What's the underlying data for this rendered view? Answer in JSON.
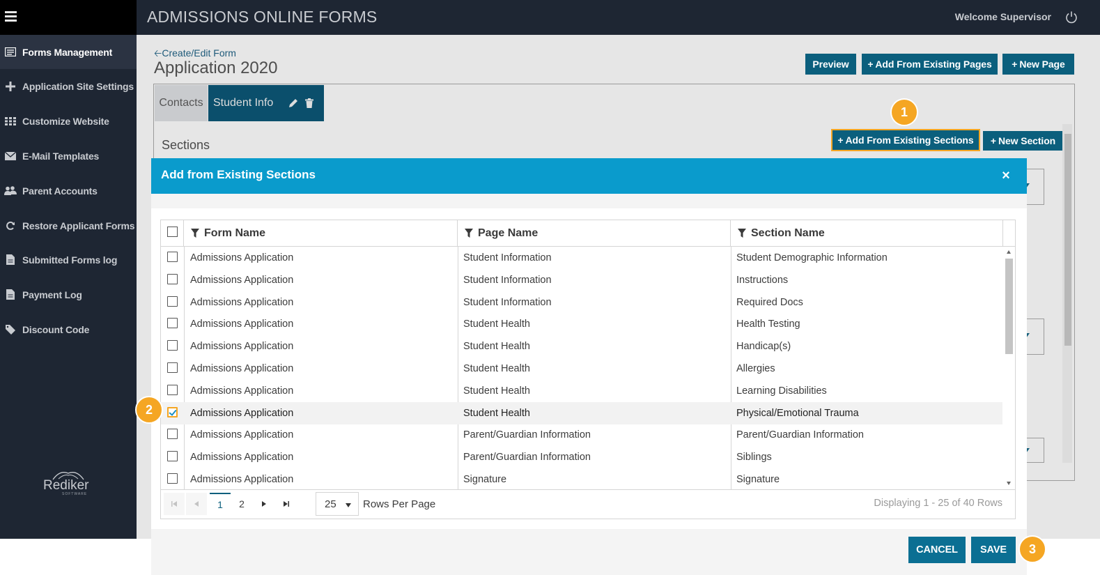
{
  "app": {
    "title": "ADMISSIONS ONLINE FORMS",
    "welcome": "Welcome Supervisor"
  },
  "sidebar": {
    "items": [
      {
        "label": "Forms Management",
        "icon": "form-icon"
      },
      {
        "label": "Application Site Settings",
        "icon": "plus-icon"
      },
      {
        "label": "Customize Website",
        "icon": "grid-icon"
      },
      {
        "label": "E-Mail Templates",
        "icon": "envelope-icon"
      },
      {
        "label": "Parent Accounts",
        "icon": "users-icon"
      },
      {
        "label": "Restore Applicant Forms",
        "icon": "refresh-icon"
      },
      {
        "label": "Submitted Forms log",
        "icon": "document-icon"
      },
      {
        "label": "Payment Log",
        "icon": "document-icon"
      },
      {
        "label": "Discount Code",
        "icon": "tag-icon"
      }
    ],
    "logo_text": "Rediker",
    "logo_sub": "SOFTWARE"
  },
  "main": {
    "breadcrumb": "Create/Edit Form",
    "page_title": "Application 2020",
    "buttons": {
      "preview": "Preview",
      "add_existing_pages": "Add From Existing Pages",
      "new_page": "New Page",
      "add_existing_sections": "Add From Existing Sections",
      "new_section": "New Section"
    },
    "tabs": [
      {
        "label": "Contacts"
      },
      {
        "label": "Student Info"
      }
    ],
    "sections_label": "Sections"
  },
  "modal": {
    "title": "Add from Existing Sections",
    "close": "×",
    "columns": [
      "Form Name",
      "Page Name",
      "Section Name"
    ],
    "rows": [
      {
        "form": "Admissions Application",
        "page": "Student Information",
        "section": "Student Demographic Information",
        "checked": false
      },
      {
        "form": "Admissions Application",
        "page": "Student Information",
        "section": "Instructions",
        "checked": false
      },
      {
        "form": "Admissions Application",
        "page": "Student Information",
        "section": "Required Docs",
        "checked": false
      },
      {
        "form": "Admissions Application",
        "page": "Student Health",
        "section": "Health Testing",
        "checked": false
      },
      {
        "form": "Admissions Application",
        "page": "Student Health",
        "section": "Handicap(s)",
        "checked": false
      },
      {
        "form": "Admissions Application",
        "page": "Student Health",
        "section": "Allergies",
        "checked": false
      },
      {
        "form": "Admissions Application",
        "page": "Student Health",
        "section": "Learning Disabilities",
        "checked": false
      },
      {
        "form": "Admissions Application",
        "page": "Student Health",
        "section": "Physical/Emotional Trauma",
        "checked": true
      },
      {
        "form": "Admissions Application",
        "page": "Parent/Guardian Information",
        "section": "Parent/Guardian Information",
        "checked": false
      },
      {
        "form": "Admissions Application",
        "page": "Parent/Guardian Information",
        "section": "Siblings",
        "checked": false
      },
      {
        "form": "Admissions Application",
        "page": "Signature",
        "section": "Signature",
        "checked": false
      }
    ],
    "pager": {
      "pages": [
        "1",
        "2"
      ],
      "current_page": "1",
      "rows_per_page": "25",
      "rows_per_page_label": "Rows Per Page",
      "displaying": "Displaying 1 - 25 of 40 Rows"
    },
    "cancel": "CANCEL",
    "save": "SAVE"
  },
  "callouts": [
    "1",
    "2",
    "3"
  ],
  "colors": {
    "topbar": "#1e2633",
    "teal_button": "#0b5f7d",
    "modal_header": "#0a9bcc",
    "callout": "#f5a623"
  }
}
